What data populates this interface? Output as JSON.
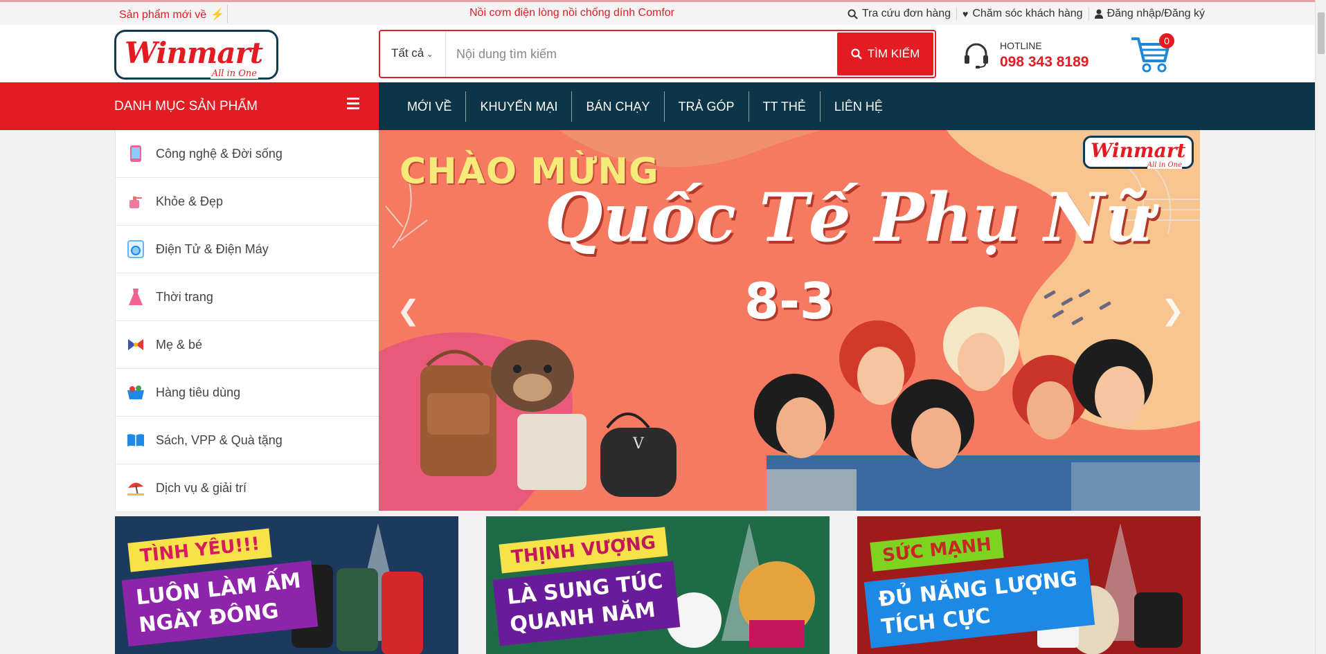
{
  "topbar": {
    "new_label": "Sản phẩm mới về",
    "marquee": "Nồi cơm điện lòng nồi chống dính Comfor",
    "links": [
      {
        "icon": "search-icon",
        "label": "Tra cứu đơn hàng"
      },
      {
        "icon": "heart-icon",
        "label": "Chăm sóc khách hàng"
      },
      {
        "icon": "user-icon",
        "label": "Đăng nhập/Đăng ký"
      }
    ]
  },
  "header": {
    "logo_text": "Winmart",
    "logo_tagline": "All in One",
    "search_category": "Tất cả",
    "search_placeholder": "Nội dung tìm kiếm",
    "search_button": "TÌM KIẾM",
    "hotline_label": "HOTLINE",
    "hotline_number": "098 343 8189",
    "cart_count": "0"
  },
  "nav": {
    "categories_label": "DANH MỤC SẢN PHẨM",
    "items": [
      "MỚI VỀ",
      "KHUYẾN MẠI",
      "BÁN CHẠY",
      "TRẢ GÓP",
      "TT THẺ",
      "LIÊN HỆ"
    ]
  },
  "sidebar": {
    "items": [
      {
        "label": "Công nghệ & Đời sống",
        "icon": "phone-icon"
      },
      {
        "label": "Khỏe & Đẹp",
        "icon": "perfume-icon"
      },
      {
        "label": "Điện Tử & Điện Máy",
        "icon": "washing-machine-icon"
      },
      {
        "label": "Thời trang",
        "icon": "dress-icon"
      },
      {
        "label": "Mẹ & bé",
        "icon": "bow-icon"
      },
      {
        "label": "Hàng tiêu dùng",
        "icon": "basket-icon"
      },
      {
        "label": "Sách, VPP & Quà tặng",
        "icon": "book-icon"
      },
      {
        "label": "Dịch vụ & giải trí",
        "icon": "beach-icon"
      }
    ]
  },
  "banner": {
    "line1": "CHÀO MỪNG",
    "line2": "Quốc Tế Phụ Nữ",
    "line3": "8-3",
    "logo_text": "Winmart",
    "logo_tagline": "All in One"
  },
  "promos": [
    {
      "tag": "TÌNH YÊU!!!",
      "lines": [
        "LUÔN LÀM ẤM",
        "NGÀY ĐÔNG"
      ],
      "bg": "#1b3a5e",
      "tag_bg": "#f7e24a",
      "tag_color": "#d81b60",
      "box_bg": "#8e24aa"
    },
    {
      "tag": "THỊNH VƯỢNG",
      "lines": [
        "LÀ SUNG TÚC",
        "QUANH NĂM"
      ],
      "bg": "#1f6b48",
      "tag_bg": "#f7e24a",
      "tag_color": "#c2185b",
      "box_bg": "#6a1b9a"
    },
    {
      "tag": "SỨC MẠNH",
      "lines": [
        "ĐỦ NĂNG LƯỢNG",
        "TÍCH CỰC"
      ],
      "bg": "#9e1b1b",
      "tag_bg": "#7ed321",
      "tag_color": "#c62828",
      "box_bg": "#1e88e5"
    }
  ],
  "colors": {
    "brand_red": "#e31b23",
    "nav_dark": "#0c3547"
  }
}
